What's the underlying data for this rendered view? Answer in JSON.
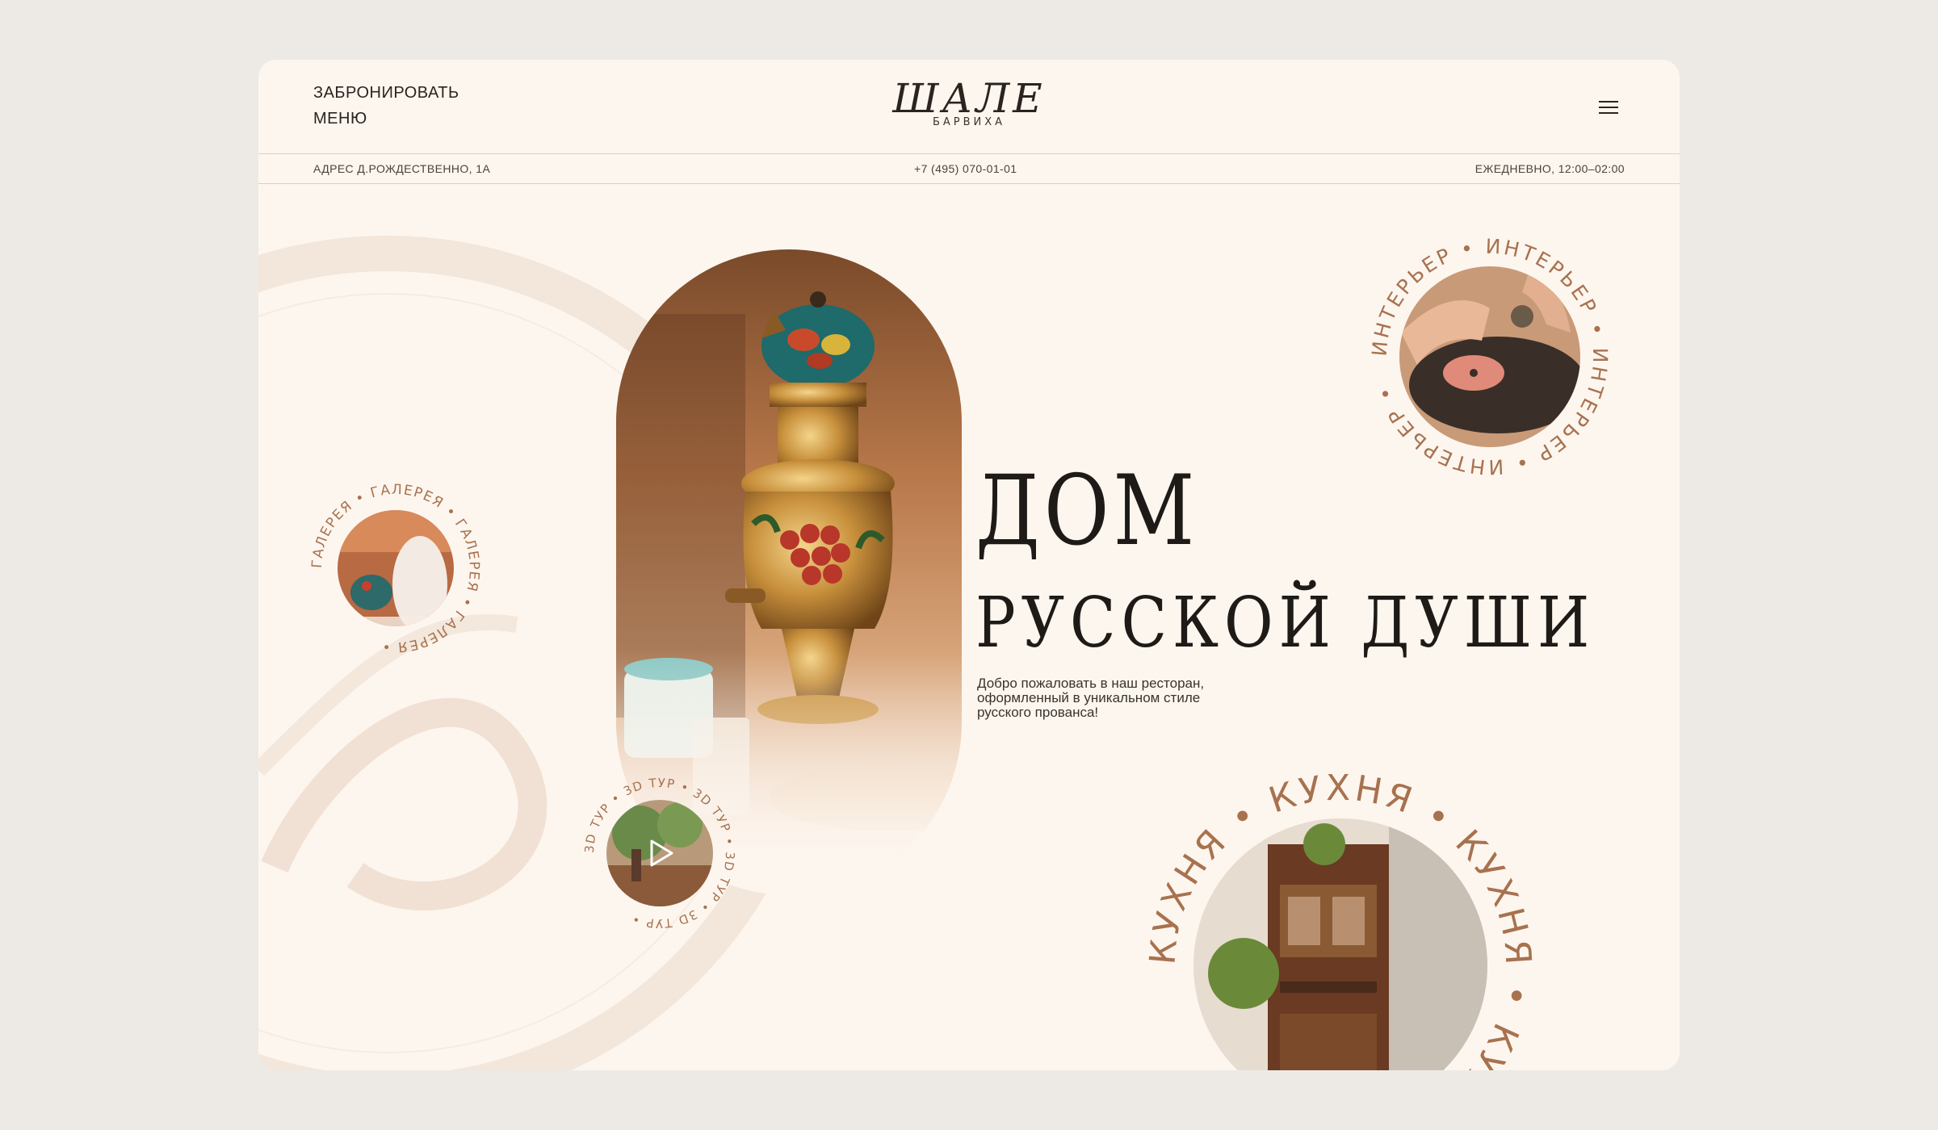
{
  "header": {
    "book_label": "ЗАБРОНИРОВАТЬ",
    "menu_label": "МЕНЮ",
    "logo_main": "ШАЛЕ",
    "logo_sub": "БАРВИХА"
  },
  "infobar": {
    "address": "АДРЕС Д.РОЖДЕСТВЕННО, 1А",
    "phone": "+7 (495) 070-01-01",
    "hours": "ЕЖЕДНЕВНО, 12:00–02:00"
  },
  "hero": {
    "headline_line1": "ДОМ",
    "headline_line2": "РУССКОЙ ДУШИ",
    "tagline_line1": "Добро пожаловать в наш ресторан,",
    "tagline_line2": "оформленный в уникальном стиле",
    "tagline_line3": "русского прованса!"
  },
  "badges": {
    "gallery": "ГАЛЕРЕЯ • ГАЛЕРЕЯ • ГАЛЕРЕЯ • ГАЛЕРЕЯ • ",
    "interior": "ИНТЕРЬЕР • ИНТЕРЬЕР • ИНТЕРЬЕР • ИНТЕРЬЕР • ",
    "tour": "3D ТУР • 3D ТУР • 3D ТУР • 3D ТУР • 3D ТУР • ",
    "kitchen": "КУХНЯ • КУХНЯ • КУХНЯ • КУХНЯ • "
  },
  "icons": {
    "menu": "hamburger-icon",
    "play": "play-icon"
  },
  "colors": {
    "background": "#fdf6ef",
    "accent": "#a8724f",
    "text": "#2a2420"
  }
}
